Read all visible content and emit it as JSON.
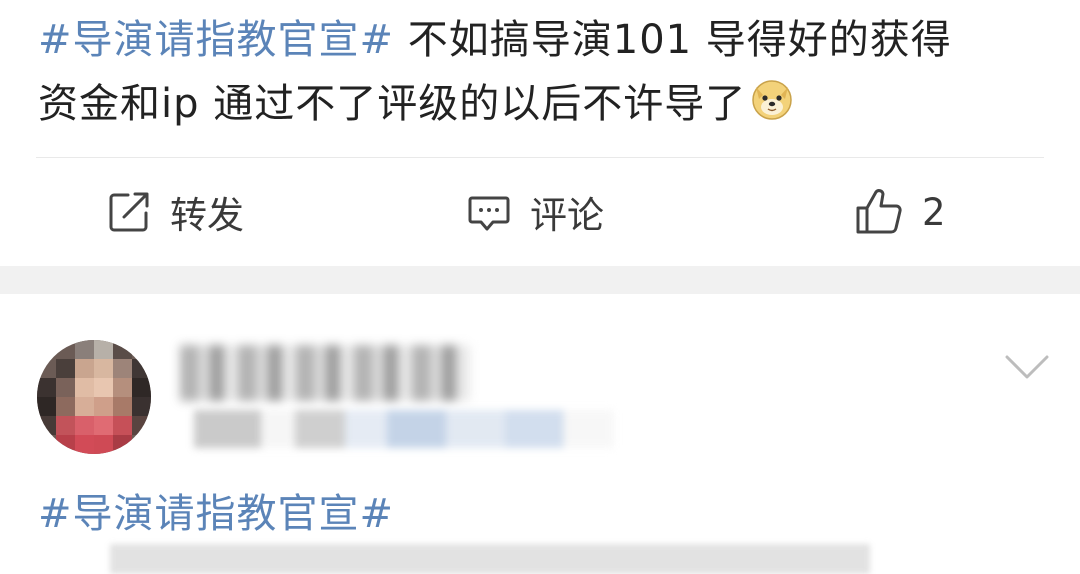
{
  "post": {
    "hashtag": "#导演请指教官宣#",
    "body_line1": " 不如搞导演101  导得好的获得",
    "body_line2": "资金和ip  通过不了评级的以后不许导了",
    "emoji": "doge-emoji"
  },
  "actions": {
    "repost_label": "转发",
    "comment_label": "评论",
    "like_count": "2"
  },
  "post2": {
    "hashtag": "#导演请指教官宣#"
  },
  "colors": {
    "hashtag": "#5b84b8",
    "text": "#222222",
    "divider_band": "#f1f1f1"
  }
}
